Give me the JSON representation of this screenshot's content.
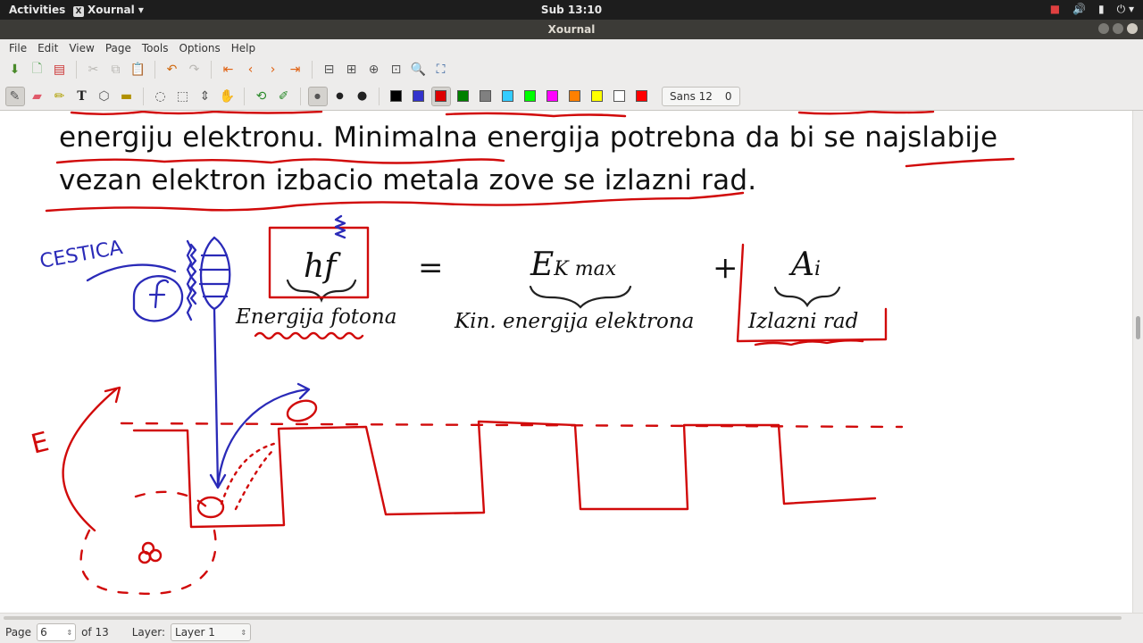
{
  "system_bar": {
    "activities": "Activities",
    "app_name": "Xournal",
    "clock": "Sub 13:10"
  },
  "window": {
    "title": "Xournal"
  },
  "menu": [
    "File",
    "Edit",
    "View",
    "Page",
    "Tools",
    "Options",
    "Help"
  ],
  "toolbar": {
    "font_name": "Sans 12",
    "font_size": "0",
    "colors": [
      "#000000",
      "#3333cc",
      "#dd0000",
      "#008000",
      "#808080",
      "#33ccff",
      "#00ff00",
      "#ff00ff",
      "#ff8000",
      "#ffff00",
      "#ffffff",
      "#ff0000"
    ],
    "selected_color": "#dd0000"
  },
  "document": {
    "line1": "energiju elektronu.  Minimalna energija potrebna da bi se najslabije",
    "line2": "vezan elektron izbacio metala zove se izlazni rad.",
    "hf": "hf",
    "equals": "=",
    "ek_main": "E",
    "ek_sub": "K max",
    "plus": "+",
    "ai_main": "A",
    "ai_sub": "i",
    "label_photon": "Energija fotona",
    "label_kinetic": "Kin. energija elektrona",
    "label_work": "Izlazni rad",
    "hand_cestica": "CESTICA",
    "hand_f": "f",
    "hand_E": "E"
  },
  "statusbar": {
    "page_label": "Page",
    "page_value": "6",
    "page_of": "of 13",
    "layer_label": "Layer:",
    "layer_value": "Layer 1"
  }
}
